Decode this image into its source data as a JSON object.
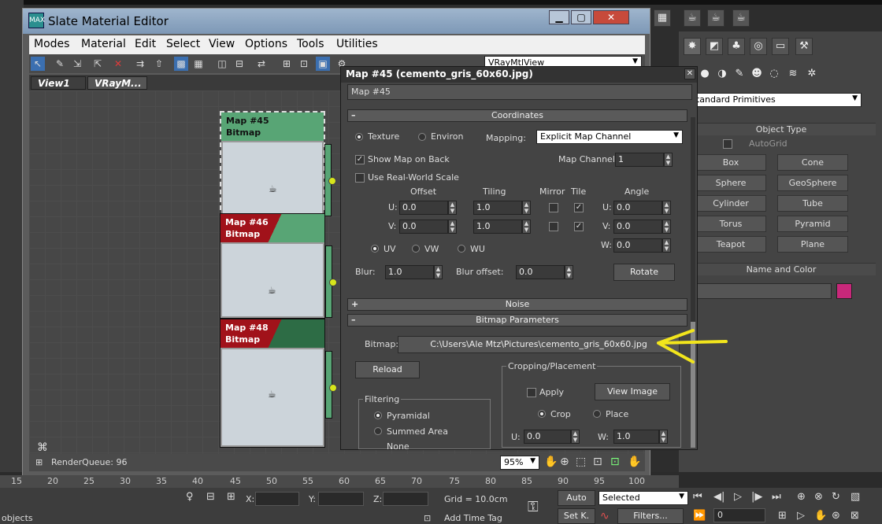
{
  "slate": {
    "title": "Slate Material Editor",
    "logo": "MAX",
    "menu": [
      "Modes",
      "Material",
      "Edit",
      "Select",
      "View",
      "Options",
      "Tools",
      "Utilities"
    ],
    "tabs": [
      "View1",
      "VRayM..."
    ],
    "view_dropdown": "VRayMtlView",
    "status": "RenderQueue: 96",
    "zoom": "95%"
  },
  "nodes": [
    {
      "name": "Map #45",
      "type": "Bitmap"
    },
    {
      "name": "Map #46",
      "type": "Bitmap"
    },
    {
      "name": "Map #48",
      "type": "Bitmap"
    }
  ],
  "mapdlg": {
    "title": "Map #45 (cemento_gris_60x60.jpg)",
    "name": "Map #45",
    "coordinates": {
      "rollout": "Coordinates",
      "texture": "Texture",
      "environ": "Environ",
      "mapping_label": "Mapping:",
      "mapping_value": "Explicit Map Channel",
      "show_map_on_back": "Show Map on Back",
      "map_channel_label": "Map Channel:",
      "map_channel_value": "1",
      "use_real_world": "Use Real-World Scale",
      "offset": "Offset",
      "tiling": "Tiling",
      "mirror": "Mirror",
      "tile": "Tile",
      "angle": "Angle",
      "u_label": "U:",
      "v_label": "V:",
      "w_label": "W:",
      "u_offset": "0.0",
      "v_offset": "0.0",
      "u_tiling": "1.0",
      "v_tiling": "1.0",
      "u_angle": "0.0",
      "v_angle": "0.0",
      "w_angle": "0.0",
      "uv": "UV",
      "vw": "VW",
      "wu": "WU",
      "blur_label": "Blur:",
      "blur_value": "1.0",
      "blur_offset_label": "Blur offset:",
      "blur_offset_value": "0.0",
      "rotate": "Rotate"
    },
    "noise_rollout": "Noise",
    "bitmap_params": {
      "rollout": "Bitmap Parameters",
      "bitmap_label": "Bitmap:",
      "bitmap_path": "C:\\Users\\Ale Mtz\\Pictures\\cemento_gris_60x60.jpg",
      "reload": "Reload",
      "cropping": "Cropping/Placement",
      "apply": "Apply",
      "view_image": "View Image",
      "crop": "Crop",
      "place": "Place",
      "u_label": "U:",
      "u_value": "0.0",
      "w_label": "W:",
      "w_value": "1.0",
      "filtering": "Filtering",
      "pyramidal": "Pyramidal",
      "summed_area": "Summed Area",
      "none": "None"
    }
  },
  "cmd_panel": {
    "category": "Standard Primitives",
    "object_type": "Object Type",
    "autogrid": "AutoGrid",
    "buttons": [
      "Box",
      "Cone",
      "Sphere",
      "GeoSphere",
      "Cylinder",
      "Tube",
      "Torus",
      "Pyramid",
      "Teapot",
      "Plane"
    ],
    "name_and_color": "Name and Color",
    "color_swatch": "#c8287a"
  },
  "timeline": {
    "ticks": [
      "15",
      "20",
      "25",
      "30",
      "35",
      "40",
      "45",
      "50",
      "55",
      "60",
      "65",
      "70",
      "75",
      "80",
      "85",
      "90",
      "95",
      "100"
    ]
  },
  "bottom": {
    "x_label": "X:",
    "y_label": "Y:",
    "z_label": "Z:",
    "grid": "Grid = 10.0cm",
    "auto": "Auto",
    "selected": "Selected",
    "setk": "Set K.",
    "filters": "Filters...",
    "frame": "0",
    "add_time_tag": "Add Time Tag",
    "objects": "objects"
  },
  "colors": {
    "node_green": "#58a575",
    "node_red": "#a1121a",
    "port_yellow": "#d7e61b",
    "annotation_arrow": "#f2e51c"
  }
}
